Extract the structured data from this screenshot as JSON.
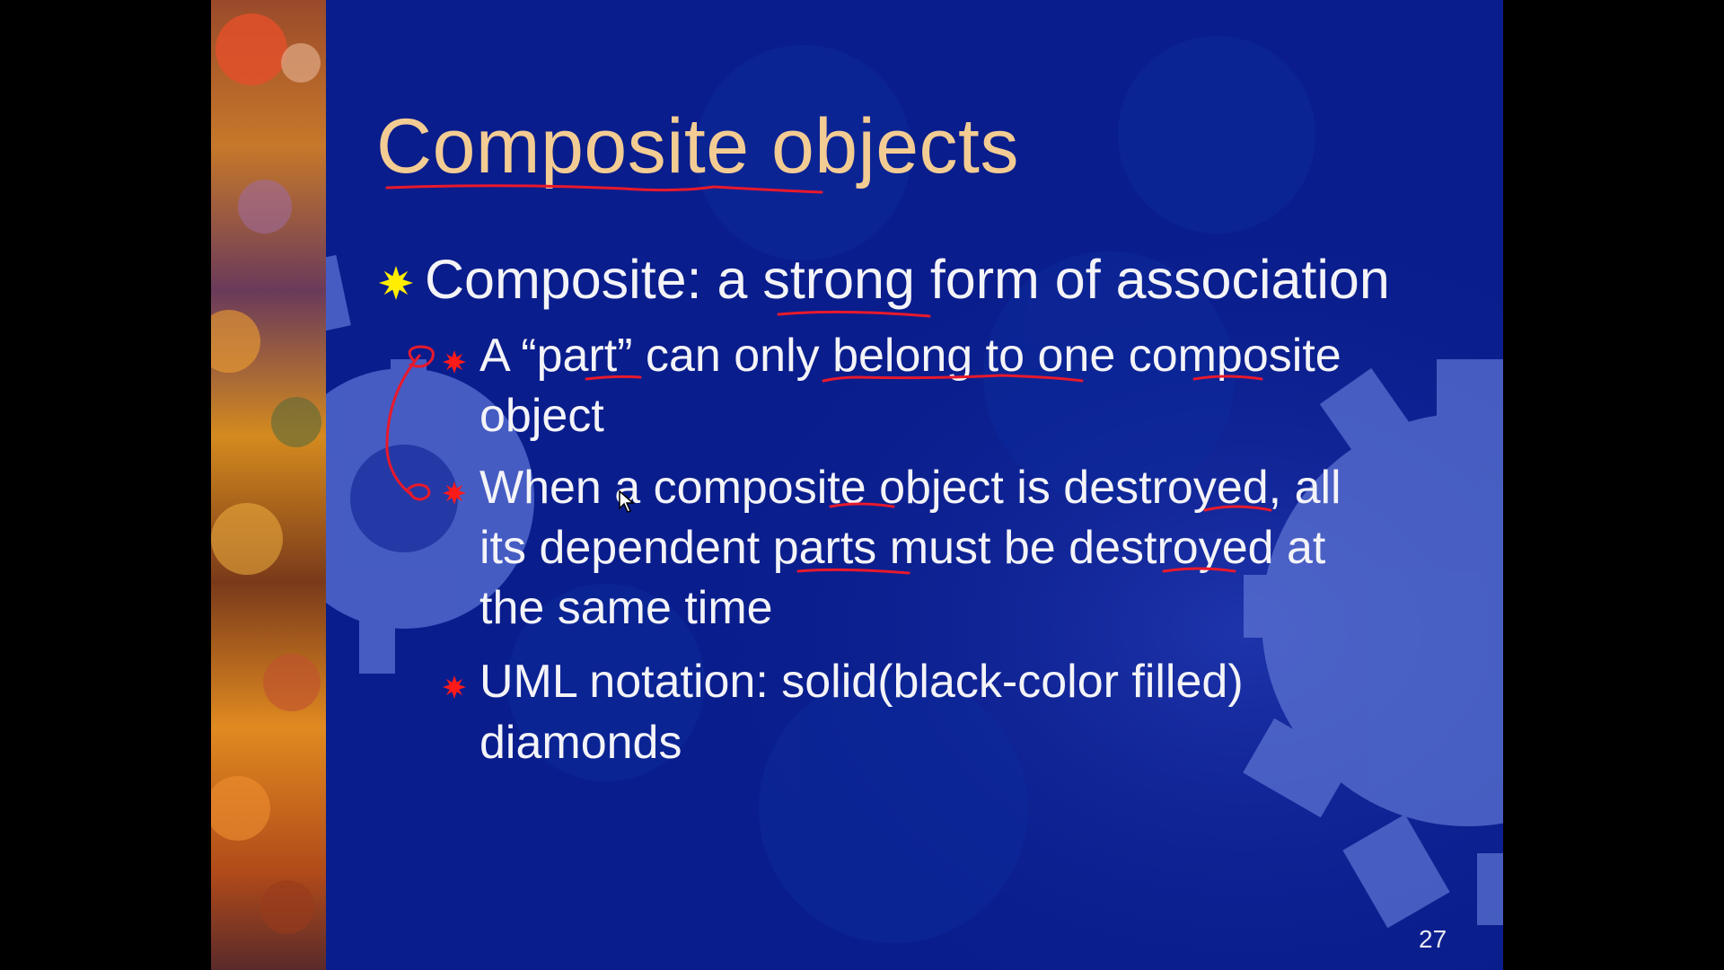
{
  "slide": {
    "title": "Composite objects",
    "bullet_main": "Composite: a strong form of association",
    "sub_bullets": [
      {
        "lines": [
          "A “part” can only belong to one composite",
          "object"
        ]
      },
      {
        "lines": [
          "When a composite object is destroyed, all",
          "its dependent parts must be destroyed at",
          "the same time"
        ]
      },
      {
        "lines": [
          "UML notation: solid(black-color filled)",
          "diamonds"
        ]
      }
    ],
    "page_number": "27"
  },
  "icons": {
    "main_bullet": "yellow-starburst-bullet-icon",
    "sub_bullet": "red-starburst-bullet-icon",
    "background": "gear-icon",
    "cursor": "mouse-pointer-icon"
  },
  "colors": {
    "slide_background": "#0a1d8c",
    "title": "#f3cc93",
    "body_text": "#f4f4f8",
    "main_bullet": "#ffee00",
    "sub_bullet": "#ff1a1a",
    "annotation_ink": "#e8192c",
    "letterbox": "#000000"
  }
}
